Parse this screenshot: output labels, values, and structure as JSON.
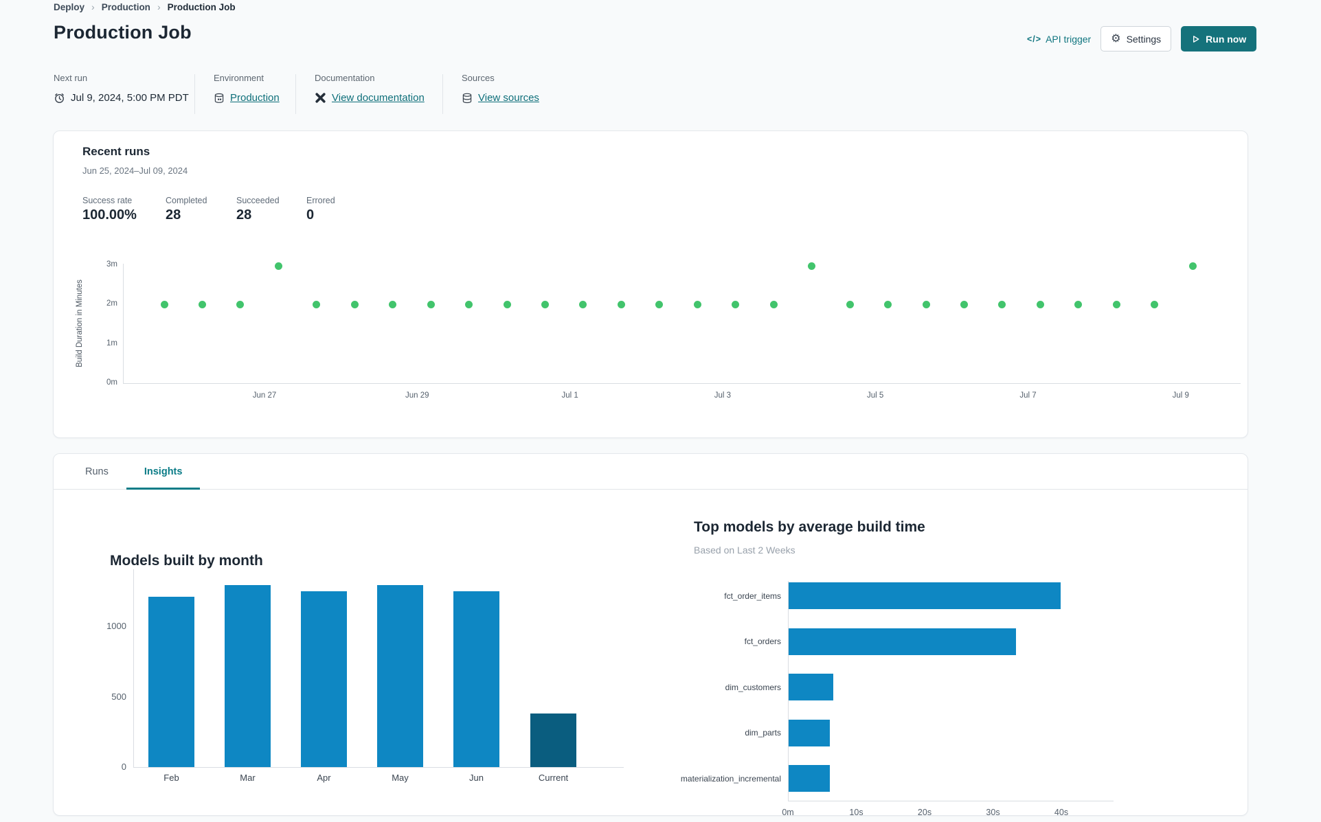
{
  "breadcrumb": {
    "items": [
      "Deploy",
      "Production",
      "Production Job"
    ]
  },
  "header": {
    "title": "Production Job",
    "api_trigger_label": "API trigger",
    "api_trigger_glyph": "</>",
    "settings_label": "Settings",
    "run_now_label": "Run now"
  },
  "meta": {
    "columns": [
      {
        "label": "Next run",
        "value": "Jul 9, 2024, 5:00 PM PDT",
        "icon": "clock-icon",
        "is_link": false
      },
      {
        "label": "Environment",
        "value": "Production",
        "icon": "environment-icon",
        "is_link": true
      },
      {
        "label": "Documentation",
        "value": "View documentation",
        "icon": "dbt-logo-icon",
        "is_link": true
      },
      {
        "label": "Sources",
        "value": "View sources",
        "icon": "database-icon",
        "is_link": true
      }
    ]
  },
  "recent_runs": {
    "title": "Recent runs",
    "date_range": "Jun 25, 2024–Jul 09, 2024",
    "stats": [
      {
        "label": "Success rate",
        "value": "100.00%"
      },
      {
        "label": "Completed",
        "value": "28"
      },
      {
        "label": "Succeeded",
        "value": "28"
      },
      {
        "label": "Errored",
        "value": "0"
      }
    ]
  },
  "tabs": [
    {
      "label": "Runs",
      "active": false
    },
    {
      "label": "Insights",
      "active": true
    }
  ],
  "colors": {
    "accent_teal": "#0b7c87",
    "run_button": "#15727b",
    "success_green": "#42c46c",
    "bar_blue": "#0e87c3",
    "bar_dark": "#0a5d7f",
    "axis_gray": "#d9dde2"
  },
  "chart_data": [
    {
      "type": "scatter",
      "title": "Recent runs",
      "ylabel": "Build Duration in Minutes",
      "y_ticks": [
        {
          "v": 0,
          "label": "0m"
        },
        {
          "v": 1,
          "label": "1m"
        },
        {
          "v": 2,
          "label": "2m"
        },
        {
          "v": 3,
          "label": "3m"
        }
      ],
      "x_ticks": [
        "Jun 27",
        "Jun 29",
        "Jul 1",
        "Jul 3",
        "Jul 5",
        "Jul 7",
        "Jul 9"
      ],
      "durations_minutes": [
        2,
        2,
        2,
        2.98,
        2,
        2,
        2,
        2,
        2,
        2,
        2,
        2,
        2,
        2,
        2,
        2,
        2,
        2.98,
        2,
        2,
        2,
        2,
        2,
        2,
        2,
        2,
        2,
        2.98
      ],
      "ylim": [
        0,
        3.2
      ],
      "grid": false,
      "point_color": "#42c46c"
    },
    {
      "type": "bar",
      "title": "Models built by month",
      "categories": [
        "Feb",
        "Mar",
        "Apr",
        "May",
        "Jun",
        "Current"
      ],
      "values": [
        1210,
        1293,
        1249,
        1293,
        1249,
        380
      ],
      "y_ticks": [
        0,
        500,
        1000
      ],
      "ylim": [
        0,
        1400
      ],
      "grid": false,
      "bar_color": "#0e87c3",
      "current_bar_color": "#0a5d7f"
    },
    {
      "type": "bar",
      "orientation": "horizontal",
      "title": "Top models by average build time",
      "subtitle": "Based on Last 2 Weeks",
      "categories": [
        "fct_order_items",
        "fct_orders",
        "dim_customers",
        "dim_parts",
        "materialization_incremental"
      ],
      "values_seconds": [
        39.8,
        33.3,
        6.5,
        6.0,
        6.0
      ],
      "x_ticks": [
        {
          "v": 0,
          "label": "0m"
        },
        {
          "v": 10,
          "label": "10s"
        },
        {
          "v": 20,
          "label": "20s"
        },
        {
          "v": 30,
          "label": "30s"
        },
        {
          "v": 40,
          "label": "40s"
        }
      ],
      "xlim": [
        0,
        45
      ],
      "grid": false,
      "bar_color": "#0e87c3"
    }
  ]
}
